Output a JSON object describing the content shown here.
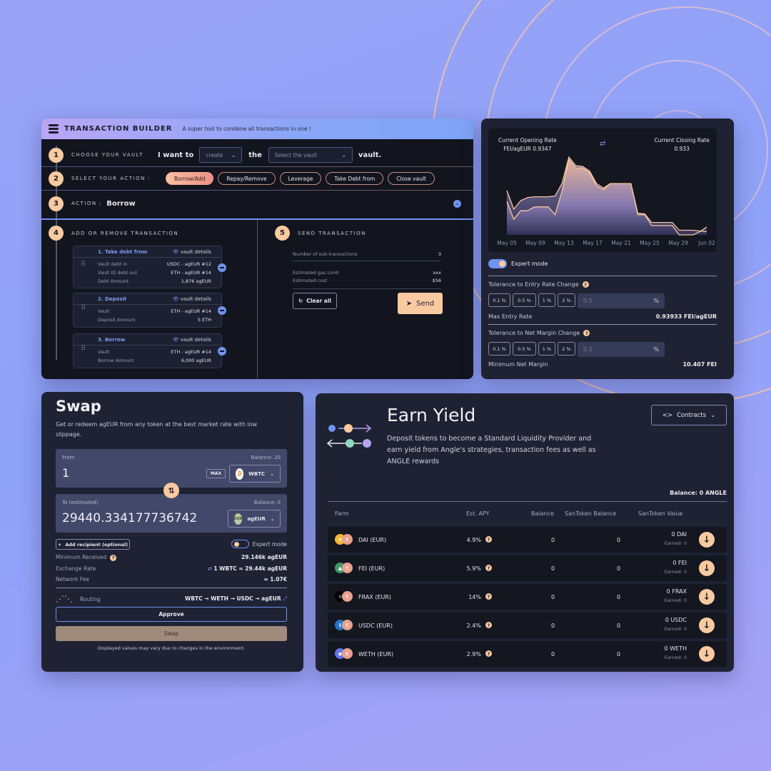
{
  "colors": {
    "accent_blue": "#6f93ee",
    "accent_peach": "#f9caa0",
    "panel": "#1f2233",
    "dark": "#12141e"
  },
  "tb": {
    "title": "TRANSACTION BUILDER",
    "subtitle": "A super tool to combine all transactions in one !",
    "step1": {
      "num": "1",
      "label": "CHOOSE YOUR VAULT",
      "i_want_to": "I want to",
      "create": "create",
      "the": "the",
      "vault_placeholder": "Select the vault",
      "vault_word": "vault."
    },
    "step2": {
      "num": "2",
      "label": "SELECT YOUR ACTION :",
      "actions": [
        "Borrow/Add",
        "Repay/Remove",
        "Leverage",
        "Take Debt from",
        "Close vault"
      ],
      "active": "Borrow/Add"
    },
    "step3": {
      "num": "3",
      "label": "ACTION :",
      "value": "Borrow"
    },
    "step4": {
      "num": "4",
      "label": "ADD OR REMOVE TRANSACTION",
      "vault_details": "vault details",
      "cards": [
        {
          "title": "1. Take debt from",
          "rows": [
            {
              "k": "Vault debt in",
              "v": "USDC - agEUR #12"
            },
            {
              "k": "Vault ID debt out",
              "v": "ETH - agEUR #14"
            },
            {
              "k": "Debt Amount",
              "v": "1,876 agEUR"
            }
          ]
        },
        {
          "title": "2. Deposit",
          "rows": [
            {
              "k": "Vault",
              "v": "ETH - agEUR #14"
            },
            {
              "k": "Deposit Amount",
              "v": "5 ETH"
            }
          ]
        },
        {
          "title": "3. Borrow",
          "rows": [
            {
              "k": "Vault",
              "v": "ETH - agEUR #14"
            },
            {
              "k": "Borrow Amount",
              "v": "6,000 agEUR"
            }
          ]
        }
      ]
    },
    "step5": {
      "num": "5",
      "label": "SEND TRANSACTION",
      "subtx_label": "Number of sub-transactions",
      "subtx_value": "3",
      "gas_label": "Estimated gas Limit",
      "gas_value": "xxx",
      "cost_label": "Estimated cost",
      "cost_value": "$56",
      "clear_label": "Clear all",
      "send_label": "Send"
    }
  },
  "rates": {
    "opening_label": "Current Opening Rate",
    "opening_value": "FEI/agEUR 0.9347",
    "closing_label": "Current Closing Rate",
    "closing_value": "0.933",
    "expert_mode": "Expert mode",
    "entry_label": "Tolerance to Entry Rate Change",
    "presets": [
      "0.1 %",
      "0.5 %",
      "1 %",
      "2 %"
    ],
    "entry_input": "0.5",
    "percent": "%",
    "max_entry_label": "Max Entry Rate",
    "max_entry_value": "0.93933 FEI/agEUR",
    "margin_label": "Tolerance to Net Margin Change",
    "margin_input": "0.5",
    "min_margin_label": "Minimum Net Margin",
    "min_margin_value": "10.407 FEI"
  },
  "chart_data": {
    "type": "area",
    "title": "",
    "xlabel": "",
    "ylabel": "",
    "x_ticks": [
      "May 05",
      "May 09",
      "May 13",
      "May 17",
      "May 21",
      "May 25",
      "May 29",
      "Jun 02"
    ],
    "x_range": [
      0,
      29
    ],
    "y_range": [
      0,
      1
    ],
    "grid": false,
    "series": [
      {
        "name": "Opening rate",
        "x": [
          0,
          1,
          2,
          3,
          4,
          5,
          6,
          7,
          8,
          9,
          10,
          11,
          12,
          13,
          14,
          15,
          16,
          17,
          18,
          19,
          20,
          21,
          22,
          23,
          24,
          25,
          26,
          27,
          28,
          29
        ],
        "values": [
          0.57,
          0.33,
          0.44,
          0.48,
          0.49,
          0.49,
          0.49,
          0.5,
          0.66,
          1.0,
          0.89,
          0.88,
          0.82,
          0.66,
          0.6,
          0.66,
          0.66,
          0.66,
          0.66,
          0.28,
          0.27,
          0.16,
          0.16,
          0.16,
          0.16,
          0.06,
          0.06,
          0.06,
          0.05,
          0.04
        ]
      },
      {
        "name": "Closing rate",
        "x": [
          0,
          1,
          2,
          3,
          4,
          5,
          6,
          7,
          8,
          9,
          10,
          11,
          12,
          13,
          14,
          15,
          16,
          17,
          18,
          19,
          20,
          21,
          22,
          23,
          24,
          25,
          26,
          27,
          28,
          29
        ],
        "values": [
          0.43,
          0.2,
          0.31,
          0.31,
          0.36,
          0.36,
          0.36,
          0.26,
          0.56,
          0.97,
          0.86,
          0.86,
          0.8,
          0.63,
          0.58,
          0.66,
          0.66,
          0.66,
          0.66,
          0.26,
          0.26,
          0.12,
          0.12,
          0.12,
          0.12,
          0.0,
          0.0,
          0.0,
          0.04,
          0.1
        ]
      }
    ]
  },
  "swap": {
    "title": "Swap",
    "desc": "Get or redeem agEUR from any token at the best market rate with low slippage.",
    "from_label": "From",
    "from_balance": "Balance: 20",
    "from_value": "1",
    "max": "MAX",
    "from_token": "WBTC",
    "to_label": "To (estimated)",
    "to_balance": "Balance: 0",
    "to_value": "29440.334177736742",
    "to_token": "agEUR",
    "add_recipient": "Add recipient (optional)",
    "expert_mode": "Expert mode",
    "min_received_label": "Minimum Received",
    "min_received_value": "29.146k agEUR",
    "rate_label": "Exchange Rate",
    "rate_value": "1 WBTC = 29.44k agEUR",
    "fee_label": "Network Fee",
    "fee_value": "≈ 1.07€",
    "routing_label": "Routing",
    "routing_value": "WBTC → WETH → USDC → agEUR",
    "approve": "Approve",
    "swap_btn": "Swap",
    "disclaimer": "Displayed values may vary due to changes in the environment."
  },
  "earn": {
    "title": "Earn Yield",
    "desc": "Deposit tokens to become a Standard Liquidity Provider and earn yield from Angle's strategies, transaction fees as well as ANGLE rewards",
    "contracts": "Contracts",
    "balance": "Balance: 0 ANGLE",
    "headers": [
      "Farm",
      "Est. APY",
      "Balance",
      "SanToken Balance",
      "SanToken Value"
    ],
    "rows": [
      {
        "farm": "DAI (EUR)",
        "apy": "4.9%",
        "balance": "0",
        "san_balance": "0",
        "value": "0 DAI",
        "earned": "Earned: 0",
        "color": "#f4b731",
        "glyph": "≡"
      },
      {
        "farm": "FEI (EUR)",
        "apy": "5.9%",
        "balance": "0",
        "san_balance": "0",
        "value": "0 FEI",
        "earned": "Earned: 0",
        "color": "#3e9a6a",
        "glyph": "▲"
      },
      {
        "farm": "FRAX (EUR)",
        "apy": "14%",
        "balance": "0",
        "san_balance": "0",
        "value": "0 FRAX",
        "earned": "Earned: 0",
        "color": "#000000",
        "glyph": "⌑"
      },
      {
        "farm": "USDC (EUR)",
        "apy": "2.4%",
        "balance": "0",
        "san_balance": "0",
        "value": "0 USDC",
        "earned": "Earned: 0",
        "color": "#2775ca",
        "glyph": "$"
      },
      {
        "farm": "WETH (EUR)",
        "apy": "2.9%",
        "balance": "0",
        "san_balance": "0",
        "value": "0 WETH",
        "earned": "Earned: 0",
        "color": "#6277ea",
        "glyph": "◆"
      }
    ]
  }
}
